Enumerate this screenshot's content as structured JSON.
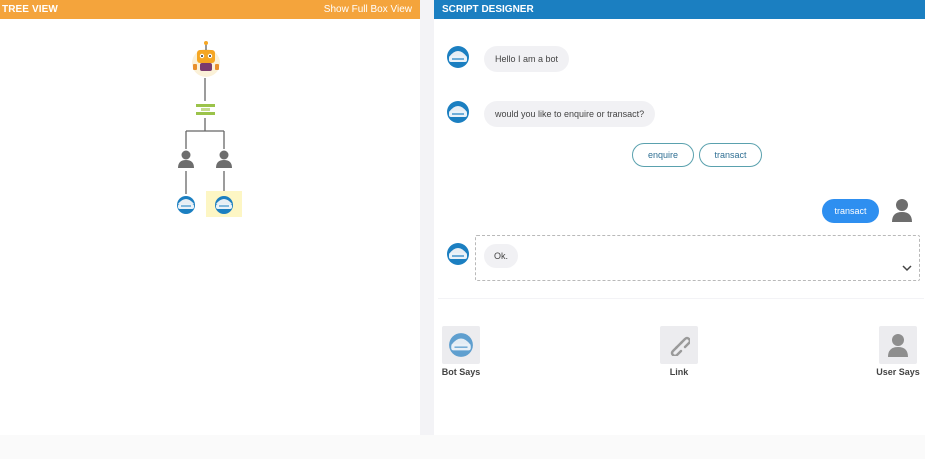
{
  "tree_view": {
    "title": "TREE VIEW",
    "full_box_link": "Show Full Box View",
    "colors": {
      "header": "#f4a43c",
      "selected_node": "#fdf6c4"
    },
    "nodes": [
      {
        "name": "root-bot-icon"
      },
      {
        "name": "condition-icon"
      },
      {
        "name": "user-node-icon-1"
      },
      {
        "name": "user-node-icon-2"
      },
      {
        "name": "bot-node-icon-1"
      },
      {
        "name": "bot-node-icon-2",
        "selected": true
      }
    ]
  },
  "script_designer": {
    "title": "SCRIPT DESIGNER",
    "colors": {
      "header": "#1b7fc1",
      "user_bubble": "#2e8ff0",
      "choice_border": "#5aa1ae"
    },
    "messages": [
      {
        "from": "bot",
        "text": "Hello I am a bot"
      },
      {
        "from": "bot",
        "text": "would you like to enquire or transact?"
      }
    ],
    "choices": [
      "enquire",
      "transact"
    ],
    "user_reply": "transact",
    "editing_message": "Ok."
  },
  "toolbox": {
    "bot_says": "Bot Says",
    "link": "Link",
    "user_says": "User Says"
  }
}
